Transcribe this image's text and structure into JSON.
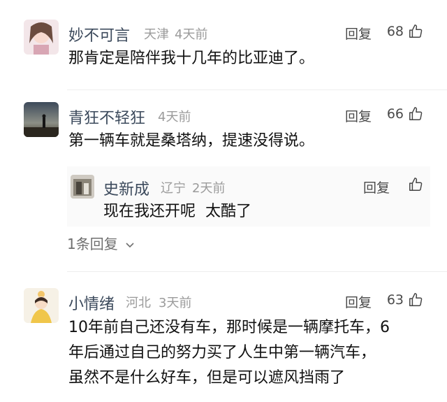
{
  "comments": [
    {
      "user": "妙不可言",
      "location": "天津",
      "time": "4天前",
      "reply_label": "回复",
      "likes": "68",
      "text": "那肯定是陪伴我十几年的比亚迪了。"
    },
    {
      "user": "青狂不轻狂",
      "location": "",
      "time": "4天前",
      "reply_label": "回复",
      "likes": "66",
      "text": "第一辆车就是桑塔纳，提速没得说。",
      "replies": [
        {
          "user": "史新成",
          "location": "辽宁",
          "time": "2天前",
          "reply_label": "回复",
          "text": "现在我还开呢  太酷了"
        }
      ],
      "more_replies": "1条回复"
    },
    {
      "user": "小情绪",
      "location": "河北",
      "time": "3天前",
      "reply_label": "回复",
      "likes": "63",
      "text_lines": [
        "10年前自己还没有车，那时候是一辆摩托车，6",
        "年后通过自己的努力买了人生中第一辆汽车，",
        "虽然不是什么好车，但是可以遮风挡雨了"
      ]
    }
  ],
  "icons": {
    "like": "thumbs-up-icon",
    "chevron": "chevron-down-icon"
  }
}
